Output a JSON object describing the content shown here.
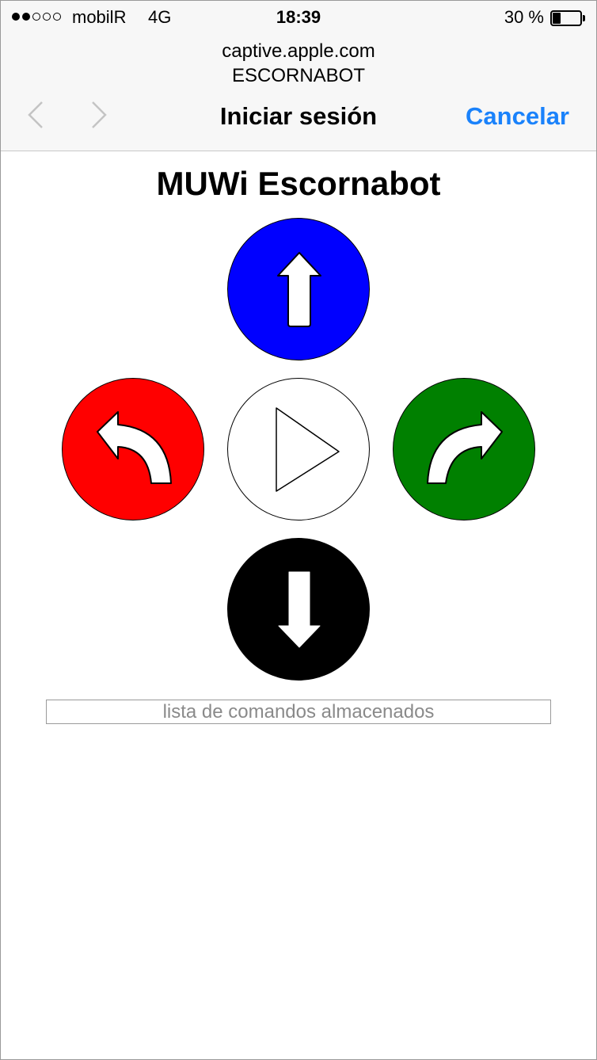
{
  "status_bar": {
    "carrier": "mobilR",
    "network": "4G",
    "time": "18:39",
    "battery": "30 %",
    "signal_bars_filled": 2,
    "signal_bars_total": 5,
    "battery_level": 0.3
  },
  "browser": {
    "url": "captive.apple.com",
    "ssid": "ESCORNABOT",
    "nav_title": "Iniciar sesión",
    "cancel_label": "Cancelar",
    "back_icon": "chevron-left-icon",
    "forward_icon": "chevron-right-icon"
  },
  "page": {
    "title": "MUWi Escornabot",
    "command_input_placeholder": "lista de comandos almacenados"
  },
  "controls": {
    "forward": {
      "icon": "arrow-up-icon",
      "color": "#0000ff"
    },
    "turn_left": {
      "icon": "arrow-turn-left-icon",
      "color": "#ff0000"
    },
    "go": {
      "icon": "play-icon",
      "color": "#ffffff"
    },
    "turn_right": {
      "icon": "arrow-turn-right-icon",
      "color": "#008000"
    },
    "backward": {
      "icon": "arrow-down-icon",
      "color": "#000000"
    }
  },
  "colors": {
    "accent": "#1a82fb",
    "header_bg": "#f7f7f7"
  }
}
